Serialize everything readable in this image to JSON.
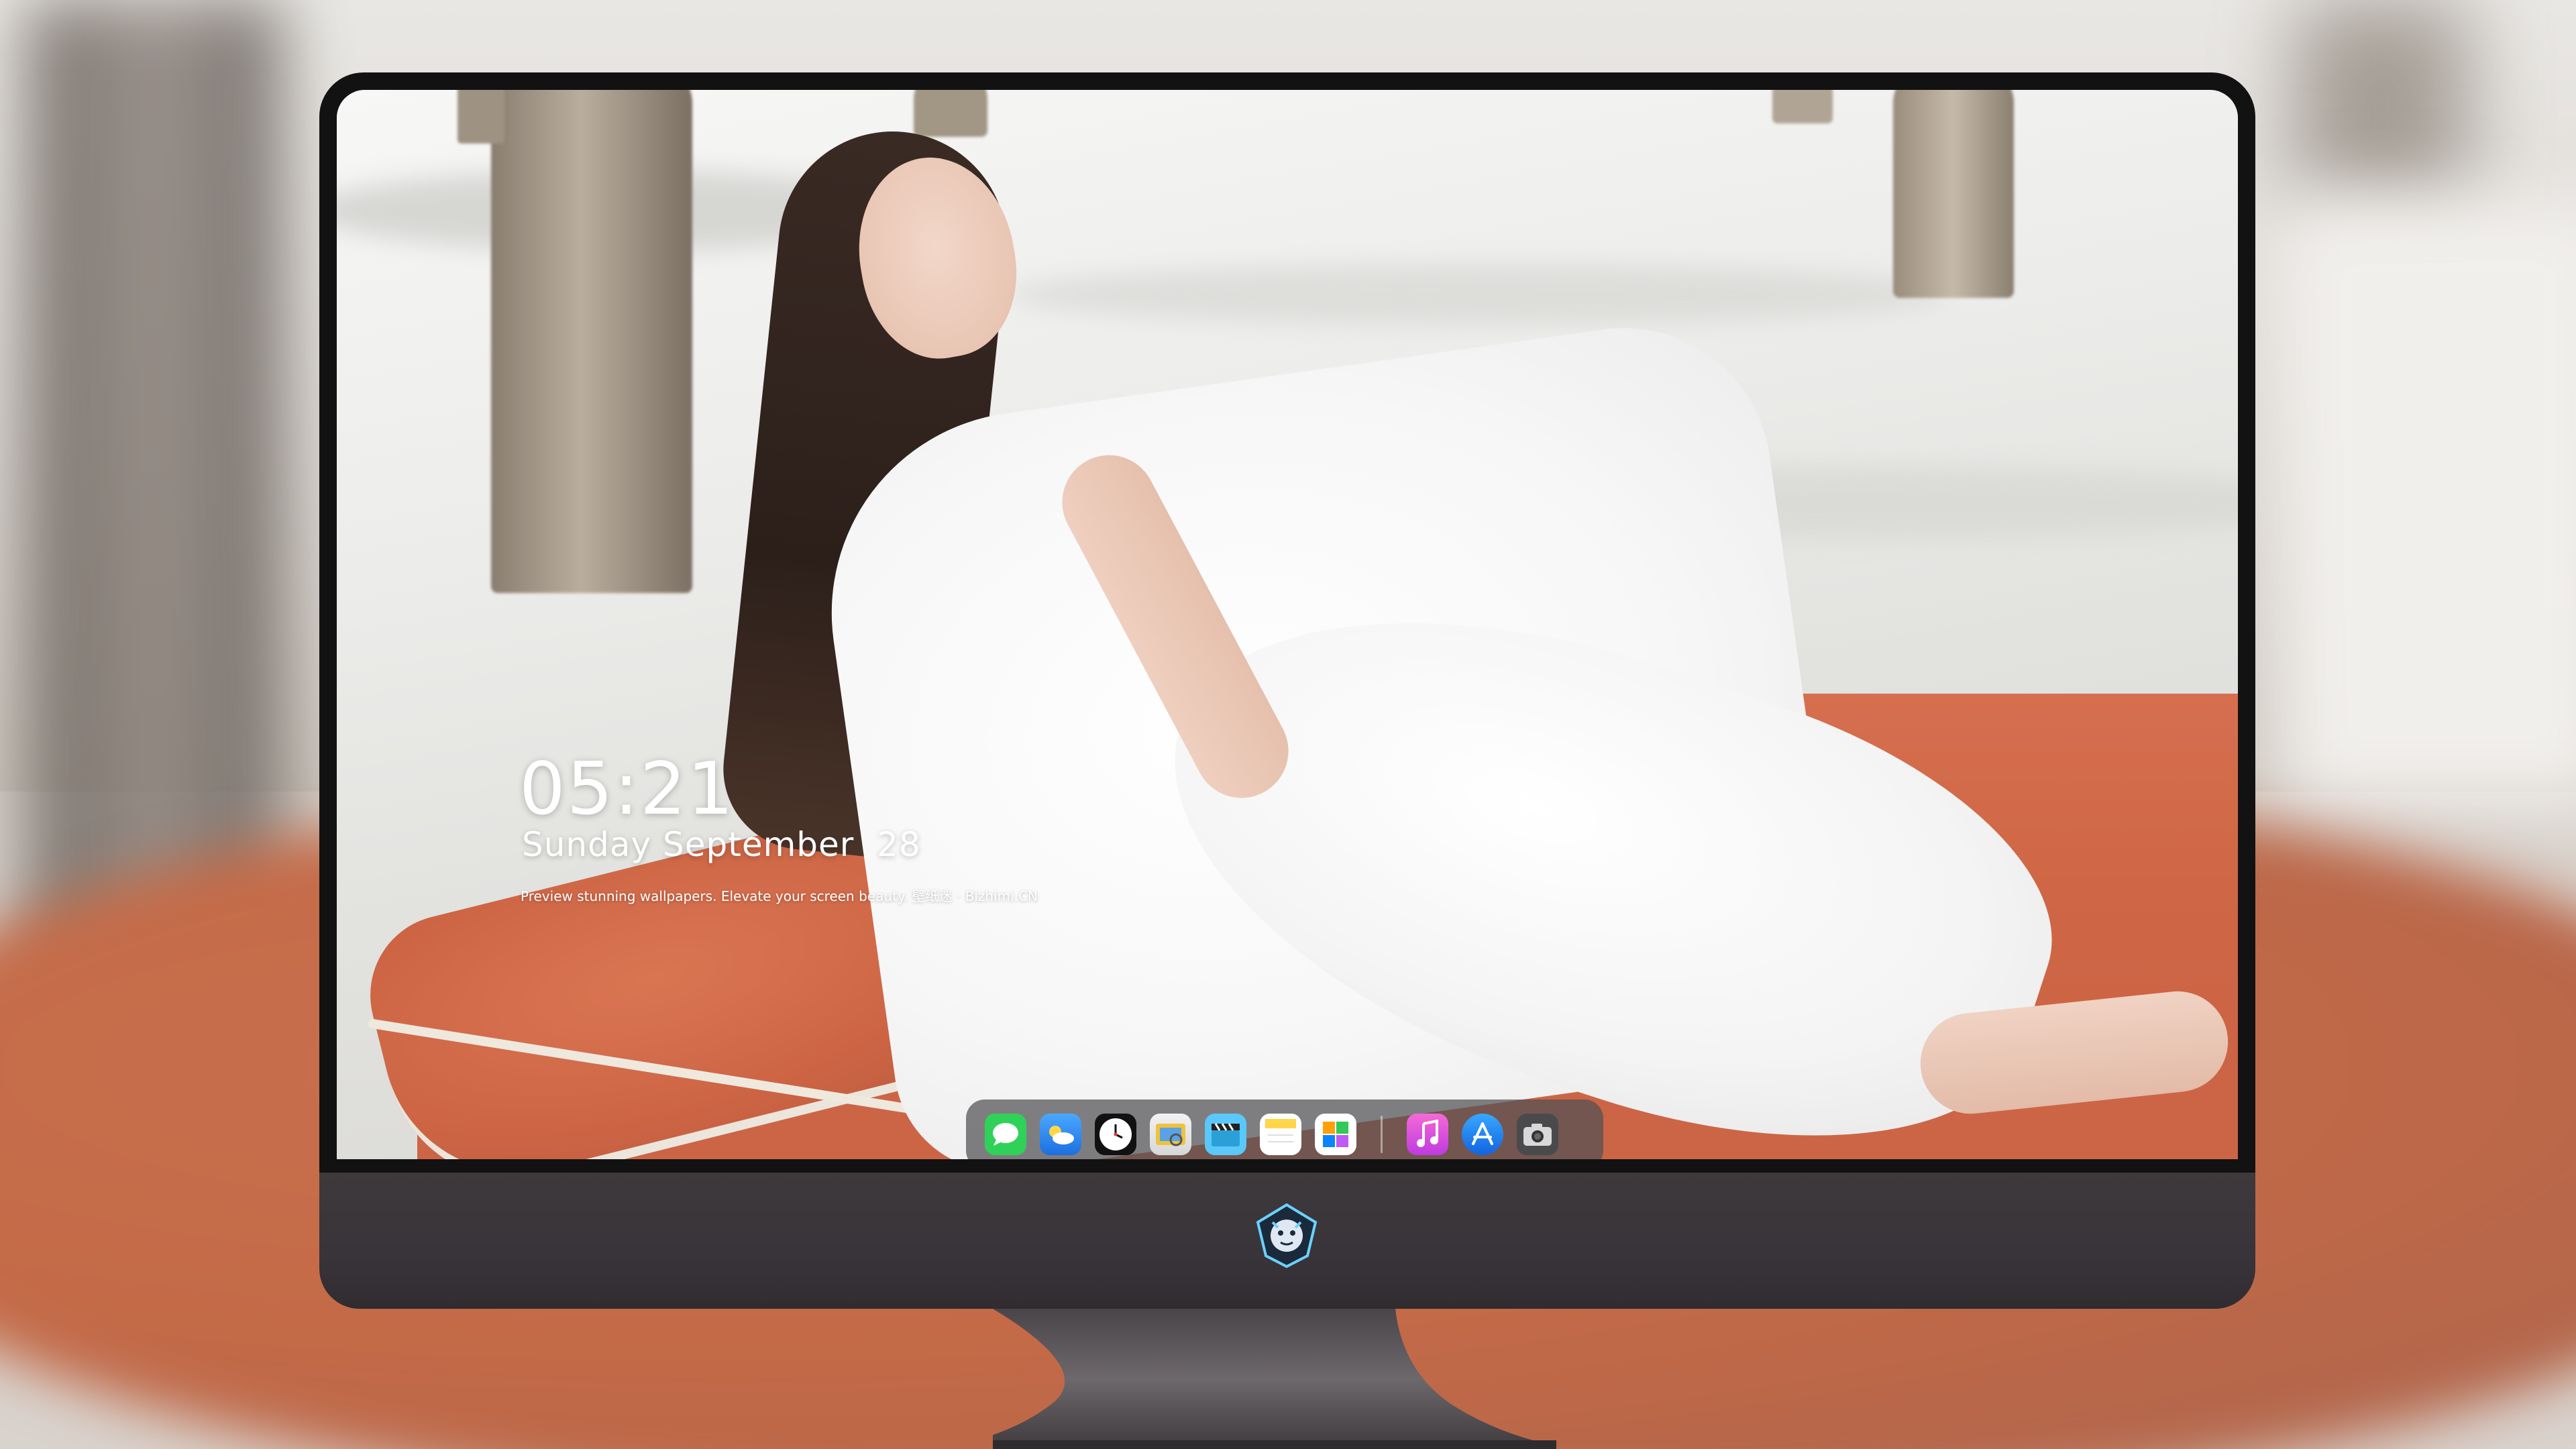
{
  "lockscreen": {
    "time": "05:21",
    "date": "Sunday September  28",
    "tagline": "Preview stunning wallpapers. Elevate your screen beauty. 壁纸迷 · Bizhimi.CN"
  },
  "dock": {
    "apps": [
      {
        "icon": "messages-icon",
        "color": "#30d158"
      },
      {
        "icon": "weather-icon",
        "color": "#2f8df0"
      },
      {
        "icon": "clock-icon",
        "color": "#111111"
      },
      {
        "icon": "preview-icon",
        "color": "#e8c54a"
      },
      {
        "icon": "clapper-icon",
        "color": "#5ac8fa"
      },
      {
        "icon": "notes-icon",
        "color": "#ffd54a"
      },
      {
        "icon": "photos-icon",
        "color": "#ffffff"
      }
    ],
    "pinned": [
      {
        "icon": "music-icon",
        "color": "#e040c8"
      },
      {
        "icon": "app-store-icon",
        "color": "#1e88f0"
      },
      {
        "icon": "camera-icon",
        "color": "#3a3a3c"
      }
    ]
  },
  "colors": {
    "bezel": "#121212",
    "chin": "#3a3538",
    "cushion": "#cf6746",
    "dock_bg": "#505054"
  }
}
